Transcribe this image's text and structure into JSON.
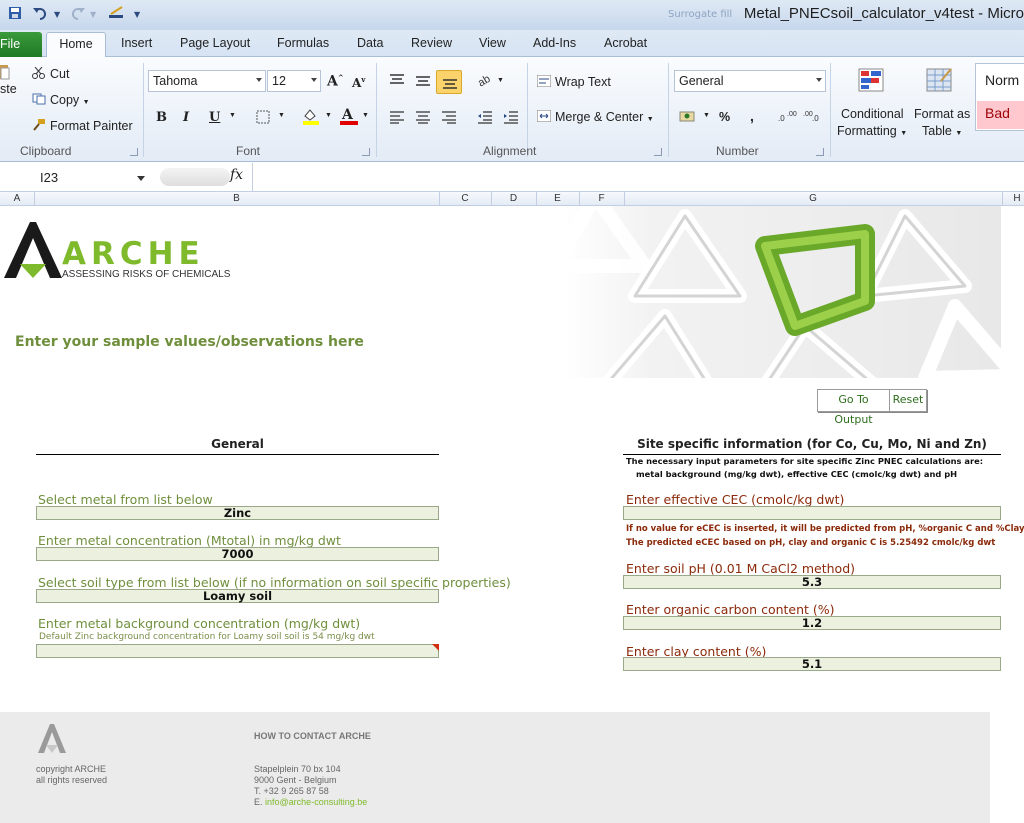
{
  "titlebar": {
    "title": "Metal_PNECsoil_calculator_v4test - Micro",
    "faded_text": "Surrogate fill"
  },
  "tabs": [
    "File",
    "Home",
    "Insert",
    "Page Layout",
    "Formulas",
    "Data",
    "Review",
    "View",
    "Add-Ins",
    "Acrobat"
  ],
  "ribbon": {
    "clipboard": {
      "paste": "ste",
      "cut": "Cut",
      "copy": "Copy",
      "format_painter": "Format Painter",
      "label": "Clipboard"
    },
    "font": {
      "name": "Tahoma",
      "size": "12",
      "label": "Font",
      "bold": "B",
      "italic": "I",
      "underline": "U"
    },
    "alignment": {
      "wrap_text": "Wrap Text",
      "merge_center": "Merge & Center",
      "label": "Alignment"
    },
    "number": {
      "format": "General",
      "label": "Number",
      "percent": "%",
      "comma": ","
    },
    "styles": {
      "conditional_1": "Conditional",
      "conditional_2": "Formatting",
      "format_table_1": "Format as",
      "format_table_2": "Table",
      "normal": "Norm",
      "bad": "Bad"
    }
  },
  "formula_bar": {
    "cell_ref": "I23",
    "fx": "fx"
  },
  "columns": [
    "A",
    "B",
    "C",
    "D",
    "E",
    "F",
    "G",
    "H"
  ],
  "sheet": {
    "logo_text": "ARCHE",
    "logo_sub": "ASSESSING RISKS OF CHEMICALS",
    "instruction": "Enter your sample values/observations here",
    "buttons": {
      "go_to_output": "Go To Output",
      "reset": "Reset"
    },
    "general": {
      "header": "General",
      "metal_label": "Select metal from list below",
      "metal_value": "Zinc",
      "conc_label": "Enter metal concentration (Mtotal) in mg/kg dwt",
      "conc_value": "7000",
      "soil_label": "Select soil type from list below (if no information on soil specific properties)",
      "soil_value": "Loamy soil",
      "bg_label": "Enter metal background concentration (mg/kg dwt)",
      "bg_note": "Default Zinc background concentration for Loamy soil soil is 54 mg/kg dwt",
      "bg_value": ""
    },
    "site": {
      "header": "Site specific information (for Co, Cu, Mo, Ni and Zn)",
      "desc_1": "The necessary input parameters for site specific Zinc PNEC calculations are:",
      "desc_2": "metal background (mg/kg dwt), effective CEC (cmolc/kg dwt) and pH",
      "cec_label": "Enter effective CEC (cmolc/kg dwt)",
      "cec_value": "",
      "cec_note_1": "If no value for eCEC is inserted, it will be predicted from pH, %organic C and %Clay",
      "cec_note_2": "The predicted eCEC based on pH, clay and organic C is 5.25492 cmolc/kg dwt",
      "ph_label": "Enter soil pH (0.01 M CaCl2 method)",
      "ph_value": "5.3",
      "oc_label": "Enter organic carbon content (%)",
      "oc_value": "1.2",
      "clay_label": "Enter clay content (%)",
      "clay_value": "5.1"
    },
    "footer": {
      "copyright_1": "copyright ARCHE",
      "copyright_2": "all rights reserved",
      "contact_title": "HOW TO CONTACT ARCHE",
      "address_1": "Stapelplein 70 bx 104",
      "address_2": "9000 Gent - Belgium",
      "phone": "T. +32 9 265 87 58",
      "email_prefix": "E.",
      "email": "info@arche-consulting.be"
    }
  },
  "colors": {
    "accent_green": "#7fba2c",
    "label_green": "#6f8f3d",
    "label_red": "#8b2a0a",
    "input_fill": "#ebf1de",
    "file_tab": "#2a8a2e",
    "bad_style": "#ffc7ce"
  }
}
